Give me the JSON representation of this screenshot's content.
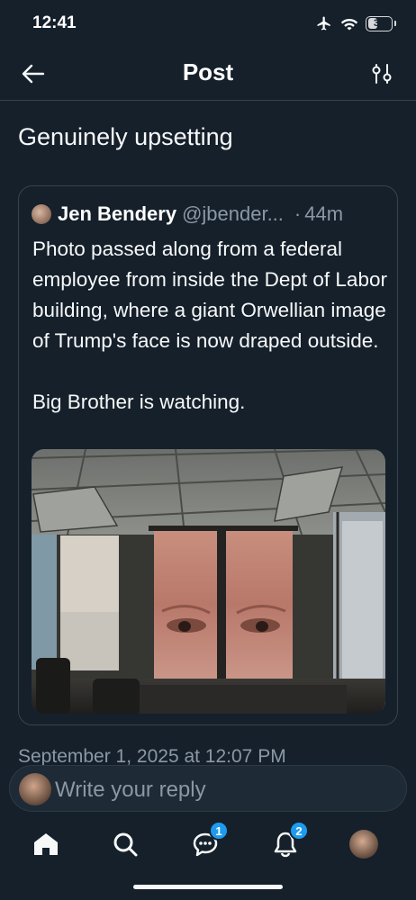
{
  "status_bar": {
    "time": "12:41",
    "battery": "39"
  },
  "header": {
    "title": "Post"
  },
  "post": {
    "text": "Genuinely upsetting",
    "timestamp": "September 1, 2025 at 12:07 PM"
  },
  "quote": {
    "author_name": "Jen Bendery",
    "author_handle": "@jbender...",
    "separator": "·",
    "time": "44m",
    "body": "Photo passed along from a federal employee from inside the Dept of Labor building, where a giant Orwellian image of Trump's face is now draped outside.\n\nBig Brother is watching."
  },
  "reply": {
    "placeholder": "Write your reply"
  },
  "tabs": [
    {
      "icon": "home-icon",
      "badge": null
    },
    {
      "icon": "search-icon",
      "badge": null
    },
    {
      "icon": "messages-icon",
      "badge": "1"
    },
    {
      "icon": "notifications-icon",
      "badge": "2"
    },
    {
      "icon": "profile-avatar",
      "badge": null
    }
  ],
  "colors": {
    "background": "#15202b",
    "accent": "#1d9bf0",
    "secondary_text": "#8b98a5",
    "border": "#38444d"
  }
}
